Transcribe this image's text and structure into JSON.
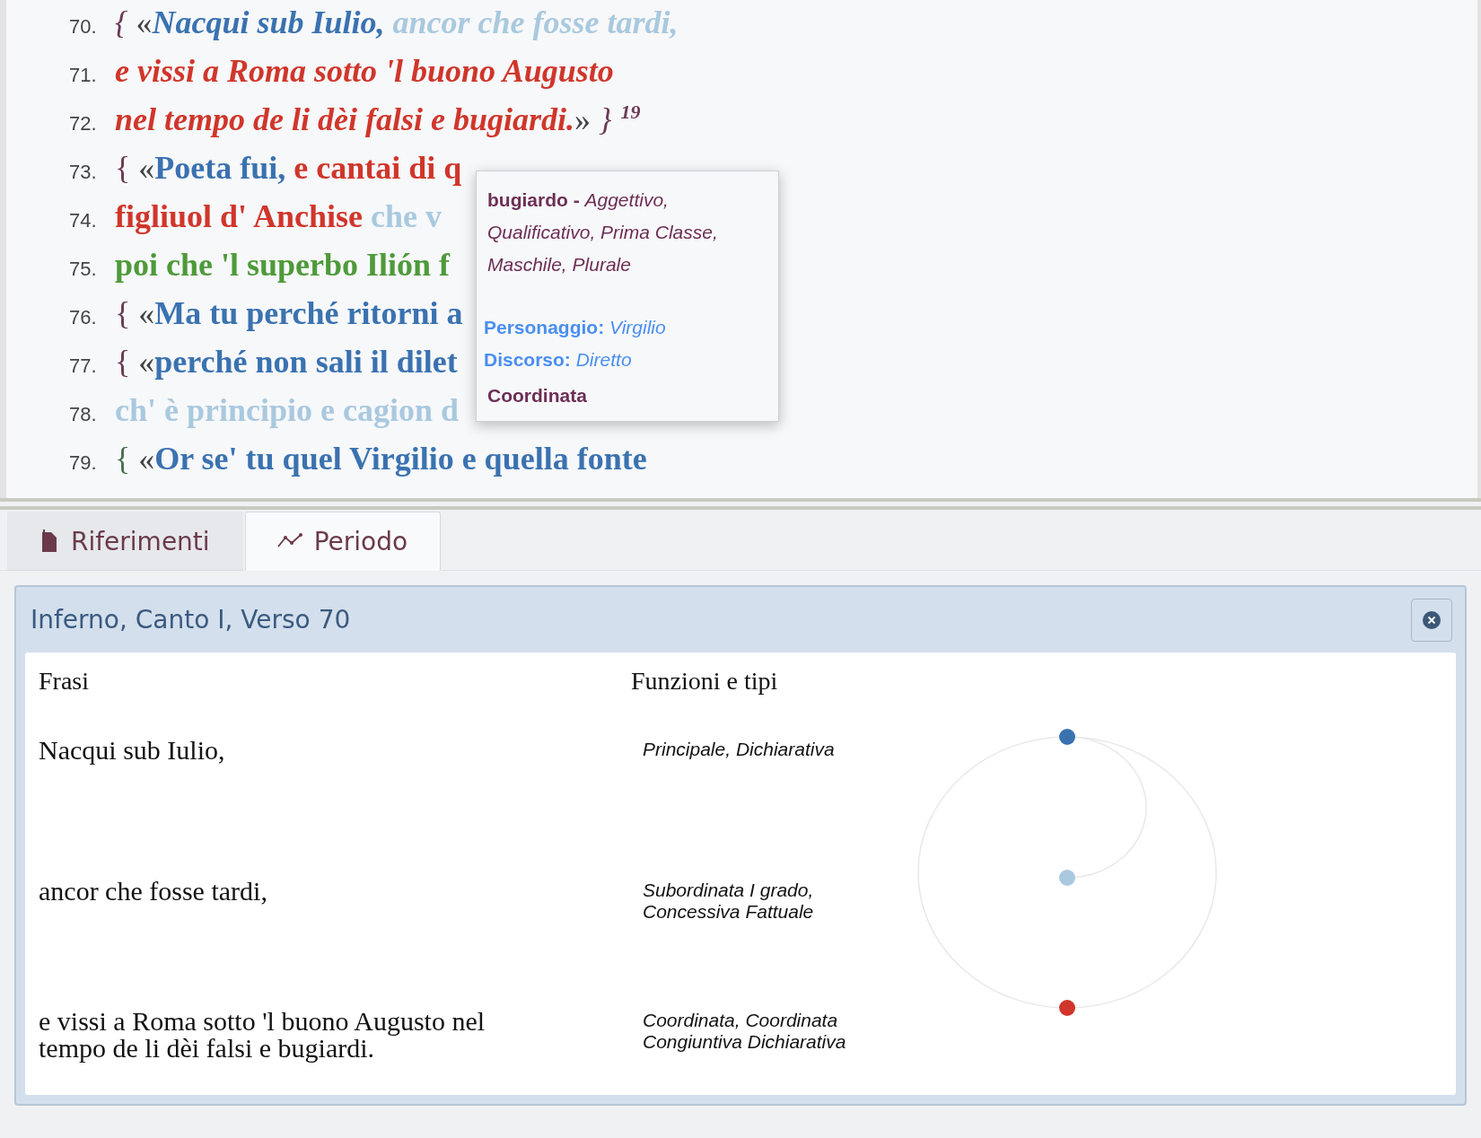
{
  "verses": [
    {
      "number": "70.",
      "italic": true,
      "segments": [
        {
          "text": "{",
          "kind": "brace",
          "color": "#6b3a55"
        },
        {
          "text": " «",
          "kind": "quote",
          "color": "#444444"
        },
        {
          "text": "Nacqui sub Iulio,",
          "kind": "clause",
          "color": "#3a72b0"
        },
        {
          "text": " ancor che fosse tardi,",
          "kind": "clause",
          "color": "#a9c9df"
        }
      ]
    },
    {
      "number": "71.",
      "italic": true,
      "segments": [
        {
          "text": "e vissi a Roma sotto 'l buono Augusto",
          "kind": "clause",
          "color": "#d0362b"
        }
      ]
    },
    {
      "number": "72.",
      "italic": true,
      "segments": [
        {
          "text": "nel tempo de li dèi falsi e bugiardi.",
          "kind": "clause",
          "color": "#d0362b"
        },
        {
          "text": "»",
          "kind": "quote",
          "color": "#444444"
        },
        {
          "text": " }",
          "kind": "brace",
          "color": "#6b3a55"
        },
        {
          "text": "19",
          "kind": "note",
          "color": "#6b3a55"
        }
      ]
    },
    {
      "number": "73.",
      "italic": false,
      "segments": [
        {
          "text": "{",
          "kind": "brace",
          "color": "#6b3a55"
        },
        {
          "text": " «",
          "kind": "quote",
          "color": "#444444"
        },
        {
          "text": "Poeta fui,",
          "kind": "clause",
          "color": "#3a72b0"
        },
        {
          "text": " e cantai di q",
          "kind": "clause",
          "color": "#d0362b"
        }
      ]
    },
    {
      "number": "74.",
      "italic": false,
      "segments": [
        {
          "text": "figliuol d' Anchise",
          "kind": "clause",
          "color": "#d0362b"
        },
        {
          "text": " che v",
          "kind": "clause",
          "color": "#a9c9df"
        }
      ]
    },
    {
      "number": "75.",
      "italic": false,
      "segments": [
        {
          "text": "poi che 'l superbo Ilión f",
          "kind": "clause",
          "color": "#4e9a3a"
        }
      ]
    },
    {
      "number": "76.",
      "italic": false,
      "segments": [
        {
          "text": "{",
          "kind": "brace",
          "color": "#6b3a55"
        },
        {
          "text": " «",
          "kind": "quote",
          "color": "#444444"
        },
        {
          "text": "Ma tu perché ritorni a",
          "kind": "clause",
          "color": "#3a72b0"
        }
      ]
    },
    {
      "number": "77.",
      "italic": false,
      "segments": [
        {
          "text": "{",
          "kind": "brace",
          "color": "#6b3a55"
        },
        {
          "text": " «",
          "kind": "quote",
          "color": "#444444"
        },
        {
          "text": "perché non sali il dilet",
          "kind": "clause",
          "color": "#3a72b0"
        }
      ]
    },
    {
      "number": "78.",
      "italic": false,
      "segments": [
        {
          "text": "ch' è principio e cagion d",
          "kind": "clause",
          "color": "#a9c9df"
        }
      ]
    },
    {
      "number": "79.",
      "italic": false,
      "segments": [
        {
          "text": "{",
          "kind": "brace",
          "color": "#4a6e50"
        },
        {
          "text": " «",
          "kind": "quote",
          "color": "#444444"
        },
        {
          "text": "Or se' tu quel Virgilio e quella fonte",
          "kind": "clause",
          "color": "#3a72b0"
        }
      ]
    }
  ],
  "tooltip": {
    "analysis": "**bugiardo -** *Aggettivo, Qualificativo, Prima Classe, Maschile, Plurale*",
    "fields": [
      {
        "label": "Personaggio:",
        "value": "Virgilio"
      },
      {
        "label": "Discorso:",
        "value": "Diretto"
      }
    ],
    "type": "Coordinata"
  },
  "tabs": [
    {
      "label": "Riferimenti",
      "selected": false
    },
    {
      "label": "Periodo",
      "selected": true
    }
  ],
  "panel": {
    "title": "Inferno, Canto I, Verso 70",
    "columns": [
      "Frasi",
      "Funzioni e tipi"
    ],
    "sentences": [
      {
        "text": "Nacqui sub Iulio,",
        "functions": "Principale, Dichiarativa",
        "color": "#3a72b0"
      },
      {
        "text": "ancor che fosse tardi,",
        "functions": "Subordinata I grado, Concessiva Fattuale",
        "color": "#a9c9df"
      },
      {
        "text": "e vissi a Roma sotto 'l buono Augusto nel tempo de li dèi falsi e bugiardi.",
        "functions": "Coordinata, Coordinata Congiuntiva Dichiarativa",
        "color": "#d0362b"
      }
    ]
  }
}
